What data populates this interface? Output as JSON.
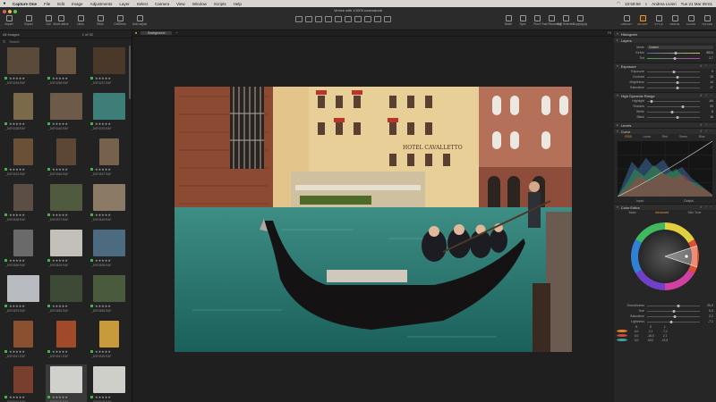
{
  "menubar": {
    "apple": "",
    "items": [
      "Capture One",
      "File",
      "Edit",
      "Image",
      "Adjustments",
      "Layer",
      "Select",
      "Camera",
      "View",
      "Window",
      "Scripts",
      "Help"
    ],
    "time_short": "10:59:59",
    "user": "Andrea Livieri",
    "datetime": "Tue 21 Mar 09:01"
  },
  "window": {
    "title": "Venice with X100V.cosessionb"
  },
  "toolbar": {
    "left_buttons": [
      "Import",
      "Export",
      "Cull"
    ],
    "mid_buttons": [
      "Move active",
      "Undo",
      "Redo",
      "Crit/Redo",
      "Auto adjust"
    ],
    "cursor_tools_label": "Cursor Tools",
    "right_buttons": [
      "Batch",
      "Sync",
      "Proof",
      "Fast Renaming",
      "Edit Selected",
      "Copy/Apply"
    ]
  },
  "tool_tabs": [
    {
      "label": "LIBRARY",
      "active": false
    },
    {
      "label": "ADJUST",
      "active": true
    },
    {
      "label": "STYLE",
      "active": false
    },
    {
      "label": "REFINE",
      "active": false
    },
    {
      "label": "SHAPE",
      "active": false
    },
    {
      "label": "TETHER",
      "active": false
    }
  ],
  "browser": {
    "collection_label": "All Images",
    "count": "1 of 32",
    "search_placeholder": "Search",
    "thumbs": [
      {
        "file": "_DSF4394.RAF",
        "stars": "★★★★★",
        "color": "#5a4a3a",
        "portrait": false,
        "selected": false
      },
      {
        "file": "_DSF4396.RAF",
        "stars": "★★★★★",
        "color": "#6a5540",
        "portrait": true,
        "selected": false
      },
      {
        "file": "_DSF4437.RAF",
        "stars": "★★★★★",
        "color": "#4a3828",
        "portrait": false,
        "selected": false
      },
      {
        "file": "_DSF4438.RAF",
        "stars": "★★★★★",
        "color": "#7a6a4a",
        "portrait": true,
        "selected": false
      },
      {
        "file": "_DSF4440.RAF",
        "stars": "★★★★★",
        "color": "#6e5a48",
        "portrait": false,
        "selected": false
      },
      {
        "file": "_DSF4475.RAF",
        "stars": "★★★★★",
        "color": "#3e7e78",
        "portrait": false,
        "selected": false
      },
      {
        "file": "_DSF4531.RAF",
        "stars": "★★★★★",
        "color": "#6b5038",
        "portrait": true,
        "selected": false
      },
      {
        "file": "_DSF4546.RAF",
        "stars": "★★★★★",
        "color": "#5e4634",
        "portrait": true,
        "selected": false
      },
      {
        "file": "_DSF4547.RAF",
        "stars": "★★★★★",
        "color": "#76624c",
        "portrait": true,
        "selected": false
      },
      {
        "file": "_DSF4608.RAF",
        "stars": "★★★★★",
        "color": "#5c4e44",
        "portrait": true,
        "selected": false
      },
      {
        "file": "_DSF4577.RAF",
        "stars": "★★★★★",
        "color": "#4f5a3e",
        "portrait": false,
        "selected": false
      },
      {
        "file": "_DSF4649.RAF",
        "stars": "★★★★★",
        "color": "#8a7a66",
        "portrait": false,
        "selected": false
      },
      {
        "file": "_DSF4826.RAF",
        "stars": "★★★★★",
        "color": "#6a6a6a",
        "portrait": true,
        "selected": false
      },
      {
        "file": "_DSF4824.RAF",
        "stars": "★★★★★",
        "color": "#c2c0b8",
        "portrait": false,
        "selected": false
      },
      {
        "file": "_DSF4835.RAF",
        "stars": "★★★★★",
        "color": "#4c6a80",
        "portrait": false,
        "selected": false
      },
      {
        "file": "_DSF4879.RAF",
        "stars": "★★★★★",
        "color": "#b8bcc0",
        "portrait": false,
        "selected": false
      },
      {
        "file": "_DSF4882.RAF",
        "stars": "★★★★★",
        "color": "#3c4a36",
        "portrait": false,
        "selected": false
      },
      {
        "file": "_DSF4883.RAF",
        "stars": "★★★★★",
        "color": "#4a5a3c",
        "portrait": false,
        "selected": false
      },
      {
        "file": "_DSF4917.RAF",
        "stars": "★★★★★",
        "color": "#8a5030",
        "portrait": true,
        "selected": false
      },
      {
        "file": "_DSF4917.RAF",
        "stars": "★★★★★",
        "color": "#a04a2a",
        "portrait": true,
        "selected": false
      },
      {
        "file": "_DSF4929.RAF",
        "stars": "★★★★★",
        "color": "#c89a3a",
        "portrait": true,
        "selected": false
      },
      {
        "file": "_DSF5016.RAF",
        "stars": "★★★★★",
        "color": "#7a3e2e",
        "portrait": true,
        "selected": false
      },
      {
        "file": "_DSF5026.RAF",
        "stars": "★★★★★",
        "color": "#d0d0cc",
        "portrait": false,
        "selected": true
      },
      {
        "file": "_DSF5025.RAF",
        "stars": "★★★★★",
        "color": "#cfcfca",
        "portrait": false,
        "selected": false
      }
    ]
  },
  "viewer": {
    "tab_label": "Background",
    "zoom_label": "Fit",
    "photo_sign": "HOTEL CAVALLETTO"
  },
  "tools": {
    "histogram": "Histogram",
    "layers": "Layers",
    "white_balance": {
      "title": "White Balance",
      "mode_label": "Mode",
      "mode_value": "Custom",
      "kelvin_label": "Kelvin",
      "kelvin_value": "5824",
      "tint_label": "Tint",
      "tint_value": "2,7"
    },
    "exposure": {
      "title": "Exposure",
      "rows": [
        {
          "label": "Exposure",
          "value": "0",
          "pos": 0.5
        },
        {
          "label": "Contrast",
          "value": "15",
          "pos": 0.58
        },
        {
          "label": "Brightness",
          "value": "14",
          "pos": 0.57
        },
        {
          "label": "Saturation",
          "value": "17",
          "pos": 0.58
        }
      ]
    },
    "hdr": {
      "title": "High Dynamic Range",
      "rows": [
        {
          "label": "Highlight",
          "value": "-84",
          "pos": 0.08
        },
        {
          "label": "Shadow",
          "value": "34",
          "pos": 0.67
        },
        {
          "label": "White",
          "value": "-5",
          "pos": 0.47
        },
        {
          "label": "Black",
          "value": "16",
          "pos": 0.58
        }
      ]
    },
    "levels": "Levels",
    "curve": {
      "title": "Curve",
      "tabs": [
        "RGB",
        "Luma",
        "Red",
        "Green",
        "Blue"
      ],
      "input_label": "Input",
      "output_label": "Output"
    },
    "color_editor": {
      "title": "Color Editor",
      "tabs": [
        "Basic",
        "Advanced",
        "Skin Tone"
      ],
      "rows": [
        {
          "label": "Smoothness",
          "value": "20,0",
          "pos": 0.6
        },
        {
          "label": "Hue",
          "value": "0,0",
          "pos": 0.5
        },
        {
          "label": "Saturation",
          "value": "2,1",
          "pos": 0.52
        },
        {
          "label": "Lightness",
          "value": "-7,1",
          "pos": 0.46
        }
      ],
      "table_head": [
        "H",
        "S",
        "L"
      ],
      "table_rows": [
        {
          "color": "#e5832a",
          "h": "0,0",
          "s": "2,1",
          "l": "-7,1"
        },
        {
          "color": "#d44a3a",
          "h": "0,0",
          "s": "-16,0",
          "l": "2,1"
        },
        {
          "color": "#3aa7a0",
          "h": "0,0",
          "s": "49,0",
          "l": "22,5"
        }
      ]
    }
  },
  "colors": {
    "accent": "#e39a3b",
    "panel": "#262626",
    "tag_green": "#3bb54a"
  }
}
